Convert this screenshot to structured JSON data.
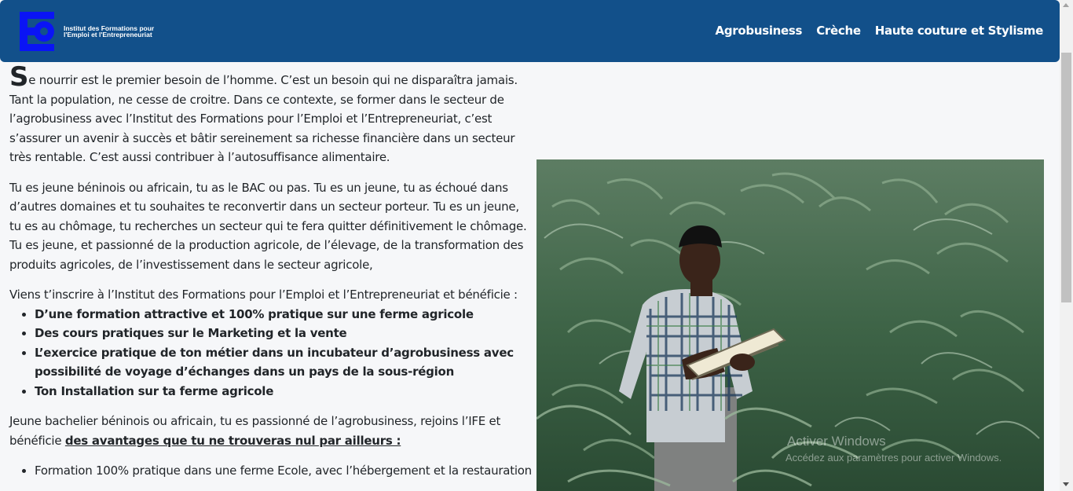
{
  "brand": {
    "logo_text_line1": "Institut des Formations pour",
    "logo_text_line2": "l'Emploi et l'Entrepreneuriat",
    "logo_color": "#0a14f5"
  },
  "nav": {
    "items": [
      {
        "label": "Agrobusiness"
      },
      {
        "label": "Crèche"
      },
      {
        "label": "Haute couture et Stylisme"
      }
    ],
    "bg_color": "#12508a"
  },
  "article": {
    "dropcap": "S",
    "para1": "e nourrir est le premier besoin de l’homme. C’est un besoin qui ne disparaîtra jamais. Tant la population, ne cesse de croitre. Dans ce contexte, se former dans le secteur de l’agrobusiness avec l’Institut des Formations pour l’Emploi et l’Entrepreneuriat, c’est s’assurer un avenir à succès et bâtir sereinement sa richesse financière dans un secteur très rentable. C’est aussi contribuer à l’autosuffisance alimentaire.",
    "para2": "Tu es jeune béninois ou africain, tu as le BAC ou pas. Tu es un jeune, tu as échoué dans d’autres domaines et tu souhaites te reconvertir dans un secteur porteur. Tu es un jeune, tu es au chômage, tu recherches un secteur qui te fera quitter définitivement le chômage. Tu es jeune, et passionné de la production agricole, de l’élevage, de la transformation des produits agricoles, de l’investissement dans le secteur agricole,",
    "para3": "Viens t’inscrire à l’Institut des Formations pour l’Emploi et l’Entrepreneuriat et bénéficie :",
    "benefits": [
      "D’une formation attractive et 100% pratique sur une ferme agricole",
      "Des cours pratiques sur le Marketing et la vente",
      "L’exercice pratique de ton métier dans un incubateur d’agrobusiness avec possibilité de voyage d’échanges dans un pays de la sous-région",
      "Ton Installation sur ta ferme agricole"
    ],
    "para4_prefix": "Jeune bachelier béninois ou africain, tu es passionné de l’agrobusiness, rejoins l’IFE et bénéficie ",
    "para4_link": "des avantages que tu ne trouveras nul par ailleurs :",
    "advantages": [
      "Formation 100% pratique dans une ferme Ecole, avec l’hébergement et la restauration"
    ]
  },
  "watermark": {
    "line1": "Activer Windows",
    "line2": "Accédez aux paramètres pour activer Windows."
  }
}
